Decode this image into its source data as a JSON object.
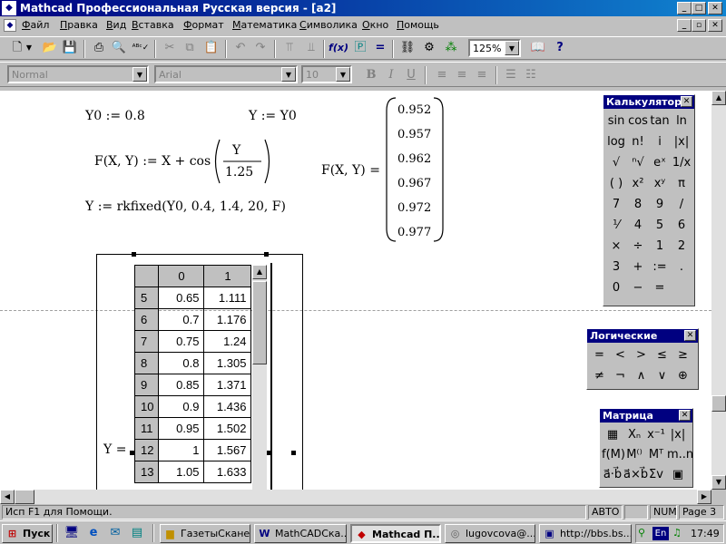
{
  "window": {
    "title": "Mathcad Профессиональная Русская версия - [a2]",
    "min_label": "_",
    "max_label": "□",
    "close_label": "✕",
    "restore_label": "▫"
  },
  "menu": [
    {
      "label": "Файл",
      "key": "Ф"
    },
    {
      "label": "Правка",
      "key": "П"
    },
    {
      "label": "Вид",
      "key": "В"
    },
    {
      "label": "Вставка",
      "key": "В"
    },
    {
      "label": "Формат",
      "key": "Ф"
    },
    {
      "label": "Математика",
      "key": "М"
    },
    {
      "label": "Символика",
      "key": "С"
    },
    {
      "label": "Окно",
      "key": "О"
    },
    {
      "label": "Помощь",
      "key": "П"
    }
  ],
  "toolbar": {
    "zoom": "125%",
    "style": "Normal",
    "font": "Arial",
    "size": "10",
    "bold": "B",
    "italic": "I",
    "underline": "U"
  },
  "worksheet": {
    "y0_def": "Y0 := 0.8",
    "y_def": "Y := Y0",
    "f_lhs": "F(X, Y) := X + cos",
    "f_num": "Y",
    "f_den": "1.25",
    "rk_def": "Y := rkfixed(Y0, 0.4, 1.4, 20, F)",
    "f_eval": "F(X, Y) =",
    "vector": [
      "0.952",
      "0.957",
      "0.962",
      "0.967",
      "0.972",
      "0.977"
    ],
    "y_eval": "Y =",
    "table": {
      "col_headers": [
        "0",
        "1"
      ],
      "rows": [
        {
          "idx": "5",
          "c0": "0.65",
          "c1": "1.111"
        },
        {
          "idx": "6",
          "c0": "0.7",
          "c1": "1.176"
        },
        {
          "idx": "7",
          "c0": "0.75",
          "c1": "1.24"
        },
        {
          "idx": "8",
          "c0": "0.8",
          "c1": "1.305"
        },
        {
          "idx": "9",
          "c0": "0.85",
          "c1": "1.371"
        },
        {
          "idx": "10",
          "c0": "0.9",
          "c1": "1.436"
        },
        {
          "idx": "11",
          "c0": "0.95",
          "c1": "1.502"
        },
        {
          "idx": "12",
          "c0": "1",
          "c1": "1.567"
        },
        {
          "idx": "13",
          "c0": "1.05",
          "c1": "1.633"
        }
      ]
    }
  },
  "palettes": {
    "calculator": {
      "title": "Калькулятор",
      "buttons": [
        "sin",
        "cos",
        "tan",
        "ln",
        "log",
        "n!",
        "i",
        "|x|",
        "√",
        "ⁿ√",
        "eˣ",
        "1/x",
        "( )",
        "x²",
        "xʸ",
        "π",
        "7",
        "8",
        "9",
        "/",
        "⅟",
        "4",
        "5",
        "6",
        "×",
        "÷",
        "1",
        "2",
        "3",
        "+",
        ":=",
        ".",
        "0",
        "−",
        "="
      ]
    },
    "logic": {
      "title": "Логические",
      "buttons": [
        "=",
        "<",
        ">",
        "≤",
        "≥",
        "≠",
        "¬",
        "∧",
        "∨",
        "⊕"
      ]
    },
    "matrix": {
      "title": "Матрица",
      "buttons": [
        "▦",
        "Xₙ",
        "x⁻¹",
        "|x|",
        "f(M)",
        "M⁽⁾",
        "Mᵀ",
        "m..n",
        "a⃗·b⃗",
        "a⃗×b⃗",
        "Σv",
        "▣"
      ]
    }
  },
  "status": {
    "help": "Исп F1 для Помощи.",
    "mode": "АВТО",
    "num": "NUM",
    "page": "Page 3"
  },
  "taskbar": {
    "start": "Пуск",
    "tasks": [
      {
        "label": "ГазетыСканер",
        "icon": "folder-icon"
      },
      {
        "label": "MathCADСка...",
        "icon": "word-icon"
      },
      {
        "label": "Mathcad П...",
        "icon": "mathcad-icon",
        "active": true
      },
      {
        "label": "lugovcova@...",
        "icon": "mail-icon"
      },
      {
        "label": "http://bbs.bs...",
        "icon": "browser-icon"
      }
    ],
    "lang": "En",
    "clock": "17:49"
  }
}
